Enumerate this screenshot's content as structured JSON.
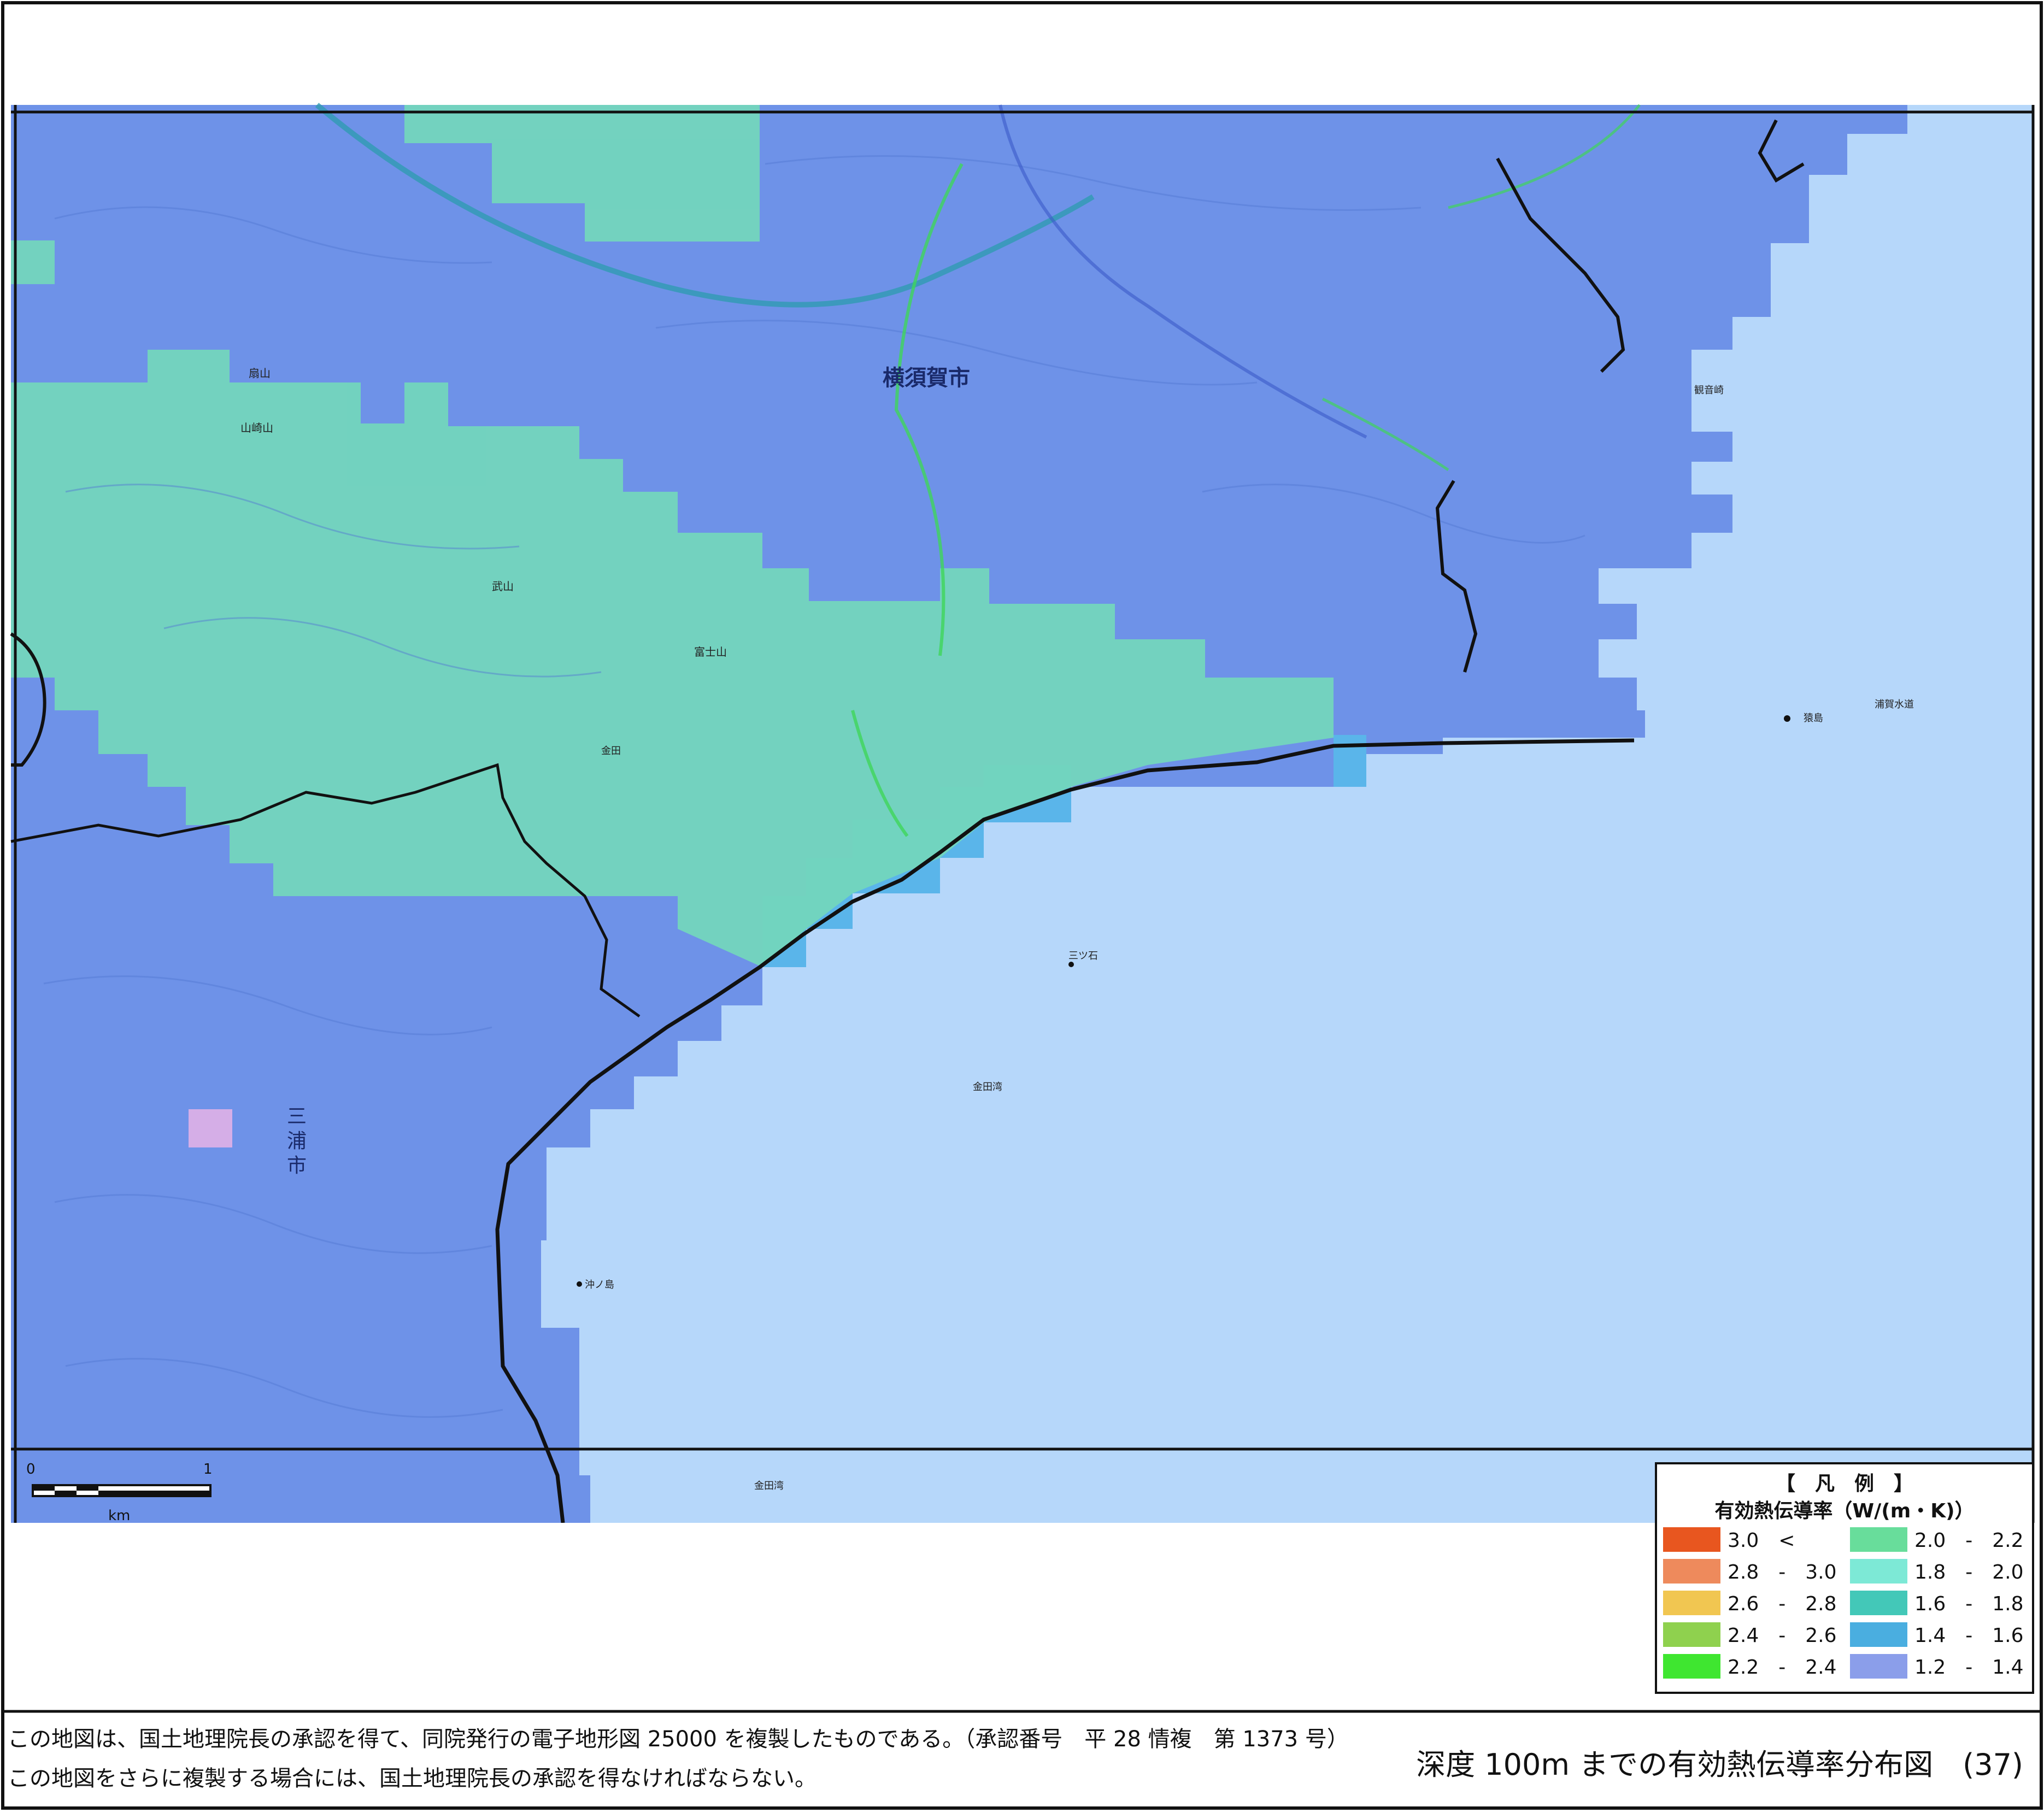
{
  "map": {
    "city_labels": {
      "yokosuka": "横須賀市",
      "miura_1": "三",
      "miura_2": "浦",
      "miura_3": "市"
    },
    "place_labels": [
      {
        "key": "mt_takeyama",
        "text": "武山"
      },
      {
        "key": "mt_fuji",
        "text": "富士山"
      },
      {
        "key": "mt_ogi",
        "text": "扇山"
      },
      {
        "key": "mt_yamazaki",
        "text": "山崎山"
      },
      {
        "key": "kanedawan",
        "text": "金田湾"
      },
      {
        "key": "kanedawan2",
        "text": "金田湾"
      },
      {
        "key": "mitsuishi",
        "text": "三ツ石"
      },
      {
        "key": "okinoshima",
        "text": "沖ノ島"
      },
      {
        "key": "kaneda",
        "text": "金田"
      },
      {
        "key": "kannonzaki",
        "text": "観音崎"
      },
      {
        "key": "sarushima",
        "text": "猿島"
      },
      {
        "key": "uraga",
        "text": "浦賀水道"
      }
    ],
    "scale_bar": {
      "start": "0",
      "end": "1",
      "unit": "km"
    }
  },
  "legend": {
    "title": "【　凡　例　】",
    "subtitle": "有効熱伝導率（W/(m・K)）",
    "items": [
      {
        "label": "3.0　<",
        "color": "#e8561f"
      },
      {
        "label": "2.8　-　3.0",
        "color": "#ee8a5c"
      },
      {
        "label": "2.6　-　2.8",
        "color": "#f1c651"
      },
      {
        "label": "2.4　-　2.6",
        "color": "#8fd14e"
      },
      {
        "label": "2.2　-　2.4",
        "color": "#3fe630"
      },
      {
        "label": "2.0　-　2.2",
        "color": "#68dd9b"
      },
      {
        "label": "1.8　-　2.0",
        "color": "#7de9d6"
      },
      {
        "label": "1.6　-　1.8",
        "color": "#43c8b8"
      },
      {
        "label": "1.4　-　1.6",
        "color": "#4aaee0"
      },
      {
        "label": "1.2　-　1.4",
        "color": "#8b9eea"
      }
    ]
  },
  "footer": {
    "note1": "この地図は、国土地理院長の承認を得て、同院発行の電子地形図 25000 を複製したものである。（承認番号　平 28 情複　第 1373 号）",
    "note2": "この地図をさらに複製する場合には、国土地理院長の承認を得なければならない。",
    "title": "深度 100m までの有効熱伝導率分布図　(37)"
  }
}
